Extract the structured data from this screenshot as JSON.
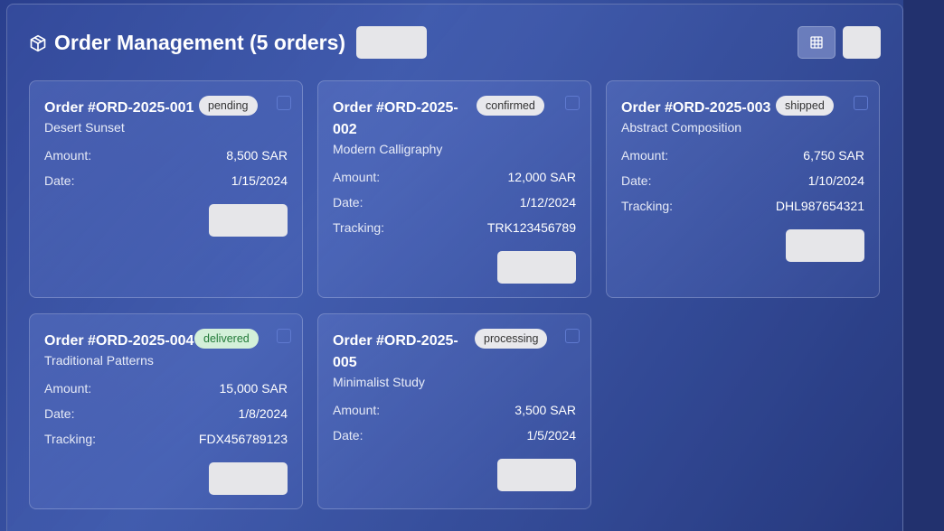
{
  "header": {
    "title": "Order Management (5 orders)",
    "icon": "package-icon"
  },
  "labels": {
    "amount": "Amount:",
    "date": "Date:",
    "tracking": "Tracking:"
  },
  "orders": [
    {
      "title": "Order #ORD-2025-001",
      "status": "pending",
      "product": "Desert Sunset",
      "amount": "8,500 SAR",
      "date": "1/15/2024",
      "tracking": ""
    },
    {
      "title": "Order #ORD-2025-002",
      "status": "confirmed",
      "product": "Modern Calligraphy",
      "amount": "12,000 SAR",
      "date": "1/12/2024",
      "tracking": "TRK123456789"
    },
    {
      "title": "Order #ORD-2025-003",
      "status": "shipped",
      "product": "Abstract Composition",
      "amount": "6,750 SAR",
      "date": "1/10/2024",
      "tracking": "DHL987654321"
    },
    {
      "title": "Order #ORD-2025-004",
      "status": "delivered",
      "product": "Traditional Patterns",
      "amount": "15,000 SAR",
      "date": "1/8/2024",
      "tracking": "FDX456789123"
    },
    {
      "title": "Order #ORD-2025-005",
      "status": "processing",
      "product": "Minimalist Study",
      "amount": "3,500 SAR",
      "date": "1/5/2024",
      "tracking": ""
    }
  ],
  "colors": {
    "background": "#2e4590",
    "delivered_badge_bg": "#d3f0d9",
    "delivered_badge_text": "#217a38",
    "checkbox_border": "#5f7ad0"
  }
}
